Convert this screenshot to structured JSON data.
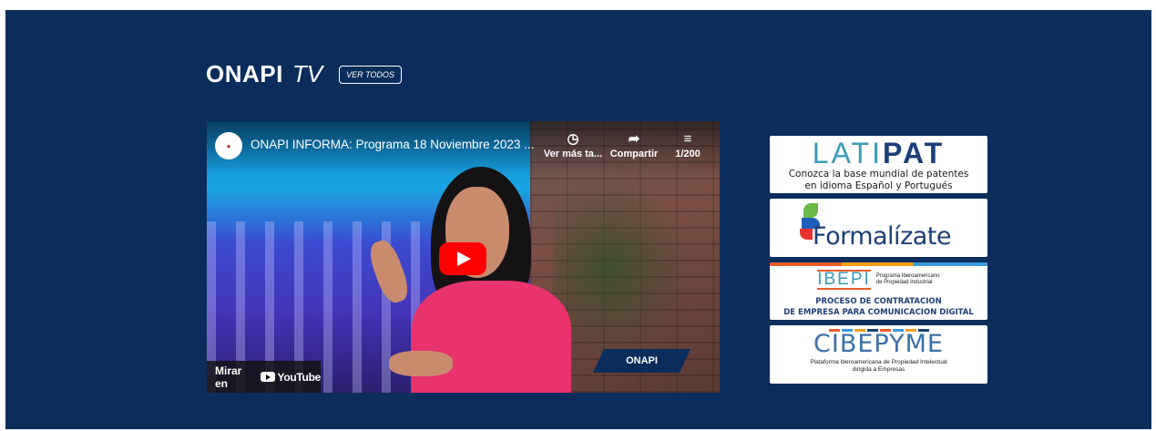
{
  "header": {
    "brand": "ONAPI",
    "brand_suffix": "TV",
    "view_all_button": "VER TODOS"
  },
  "video": {
    "title": "ONAPI INFORMA: Programa 18 Noviembre 2023 ...",
    "actions": [
      {
        "icon": "clock-icon",
        "label": "Ver más ta..."
      },
      {
        "icon": "share-icon",
        "label": "Compartir"
      },
      {
        "icon": "playlist-icon",
        "label": "1/200"
      }
    ],
    "watch_on": "Mirar en",
    "youtube": "YouTube",
    "lower_third": "ONAPI"
  },
  "banners": {
    "latipat": {
      "logo_a": "LATI",
      "logo_b": "PAT",
      "line1": "Conozca la base mundial de patentes",
      "line2": "en idioma Español y Portugués"
    },
    "formalizate": {
      "logo": "Formalízate"
    },
    "ibepi": {
      "logo": "IBEPI",
      "program": "Programa Iberoamericano de Propiedad Industrial",
      "title1": "PROCESO DE CONTRATACION",
      "title2": "DE EMPRESA PARA COMUNICACION DIGITAL"
    },
    "cibepyme": {
      "logo": "CIBEPYME",
      "line1": "Plataforma Iberoamericana de Propiedad Intelectual",
      "line2": "dirigida a Empresas"
    }
  },
  "colors": {
    "background": "#0b2d5b",
    "youtube_red": "#ff0000",
    "accent_blue": "#1d3f78"
  }
}
